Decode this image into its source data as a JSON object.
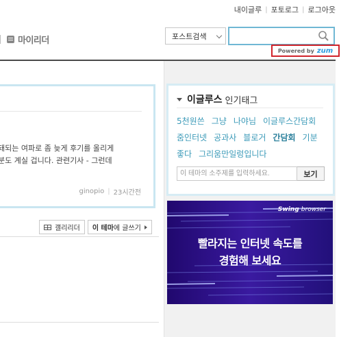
{
  "top_links": [
    "내이글루",
    "포토로그",
    "로그아웃"
  ],
  "header": {
    "my_reader_label": "마이리더"
  },
  "search": {
    "select_label": "포스트검색",
    "input_value": "",
    "powered_by_text": "Powered by",
    "powered_by_brand": "zum"
  },
  "post": {
    "excerpt_lines": [
      "돼되는 여파로 좀 늦게 후기를 올리게",
      "분도 계실 겁니다. 관련기사 - 그런데"
    ],
    "author": "ginopio",
    "time": "23시간전"
  },
  "actions": {
    "gallery_reader_label": "갤리리더",
    "write_prefix": "이 테마",
    "write_suffix": "에 글쓰기"
  },
  "popular_tags": {
    "theme_name": "이글루스",
    "title_suffix": "인기태그",
    "tags": [
      {
        "label": "5천원쓴",
        "strong": false
      },
      {
        "label": "그냥",
        "strong": false
      },
      {
        "label": "나야님",
        "strong": false
      },
      {
        "label": "이글루스간담회",
        "strong": false
      },
      {
        "label": "줌인터넷",
        "strong": false
      },
      {
        "label": "공과사",
        "strong": false
      },
      {
        "label": "블로거",
        "strong": false
      },
      {
        "label": "간담회",
        "strong": true
      },
      {
        "label": "기분",
        "strong": false
      },
      {
        "label": "좋다",
        "strong": false
      },
      {
        "label": "그리움만일렁입니다",
        "strong": false
      }
    ],
    "topic_placeholder": "이 테마의 소주제를 입력하세요.",
    "topic_button": "보기"
  },
  "banner": {
    "brand_main": "Swing",
    "brand_sub": "browser",
    "headline_line1": "빨라지는 인터넷 속도를",
    "headline_line2": "경험해 보세요",
    "background_color": "#32138f"
  },
  "colors": {
    "accent_blue": "#3b9ab8",
    "search_border": "#6fb7d4",
    "powered_border": "#d0232a",
    "zum_brand": "#2a9be0"
  }
}
